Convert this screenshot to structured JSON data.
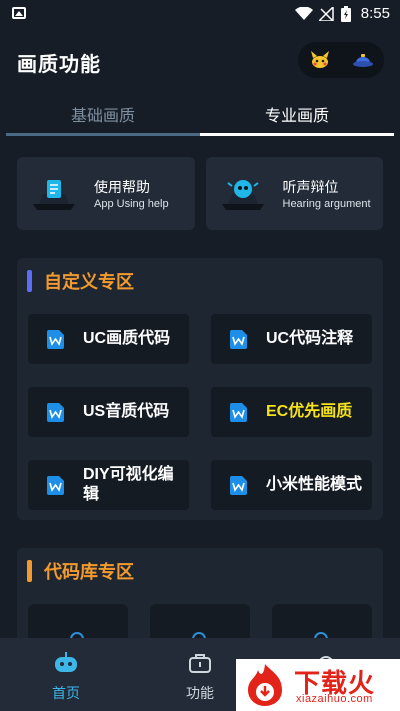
{
  "status": {
    "time": "8:55"
  },
  "header": {
    "title": "画质功能"
  },
  "tabs": [
    {
      "label": "基础画质"
    },
    {
      "label": "专业画质"
    }
  ],
  "help_cards": [
    {
      "title": "使用帮助",
      "subtitle": "App Using help"
    },
    {
      "title": "听声辩位",
      "subtitle": "Hearing argument"
    }
  ],
  "custom_section": {
    "title": "自定义专区",
    "accent": "#5b6ef5",
    "items": [
      {
        "label": "UC画质代码"
      },
      {
        "label": "UC代码注释"
      },
      {
        "label": "US音质代码"
      },
      {
        "label": "EC优先画质"
      },
      {
        "label": "DIY可视化编辑"
      },
      {
        "label": "小米性能模式"
      }
    ]
  },
  "library_section": {
    "title": "代码库专区",
    "accent": "#f29a2e"
  },
  "bottom_nav": [
    {
      "label": "首页"
    },
    {
      "label": "功能"
    }
  ],
  "watermark": {
    "text": "下载火",
    "sub": "xiazaihuo.com"
  },
  "colors": {
    "background": "#161d27",
    "card": "#222b37",
    "section_title": "#f29a2e",
    "highlight": "#f5e21b",
    "active_nav": "#3db6e8"
  }
}
